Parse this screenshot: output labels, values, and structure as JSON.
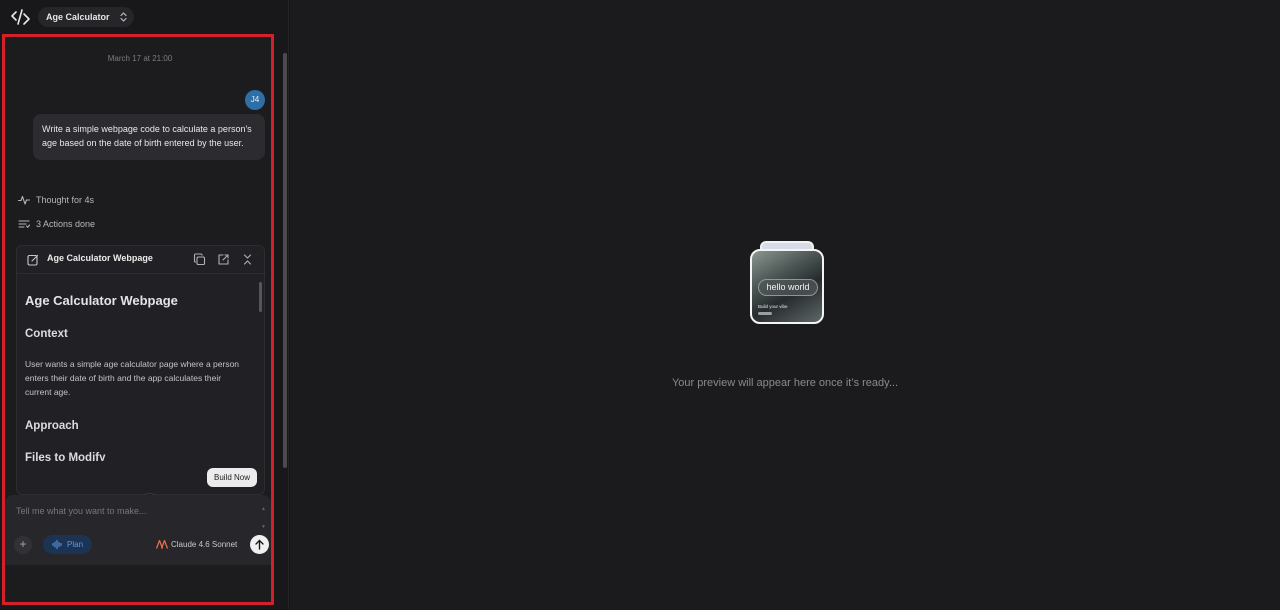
{
  "app": {
    "project_name": "Age Calculator",
    "logo_icon": "code-slash-icon"
  },
  "chat": {
    "timestamp": "March 17 at 21:00",
    "user_initials": "J4",
    "user_message": "Write a simple webpage code to calculate a person's age based on the date of birth entered by the user.",
    "steps": {
      "thought": "Thought for 4s",
      "actions": "3 Actions done"
    }
  },
  "plan_card": {
    "title": "Age Calculator Webpage",
    "doc_heading": "Age Calculator Webpage",
    "context_heading": "Context",
    "context_text": "User wants a simple age calculator page where a person enters their date of birth and the app calculates their current age.",
    "approach_heading": "Approach",
    "files_heading": "Files to Modify",
    "build_label": "Build Now"
  },
  "composer": {
    "placeholder": "Tell me what you want to make...",
    "mode_label": "Plan",
    "model_label": "Claude 4.6 Sonnet"
  },
  "preview": {
    "illustration_text": "hello world",
    "illustration_subtext": "Build your vibe",
    "message": "Your preview will appear here once it’s ready..."
  },
  "colors": {
    "highlight_border": "#d4202a",
    "avatar_bg": "#2e6fa6",
    "plan_toggle_text": "#5a97e6",
    "model_logo": "#e36d4b"
  }
}
